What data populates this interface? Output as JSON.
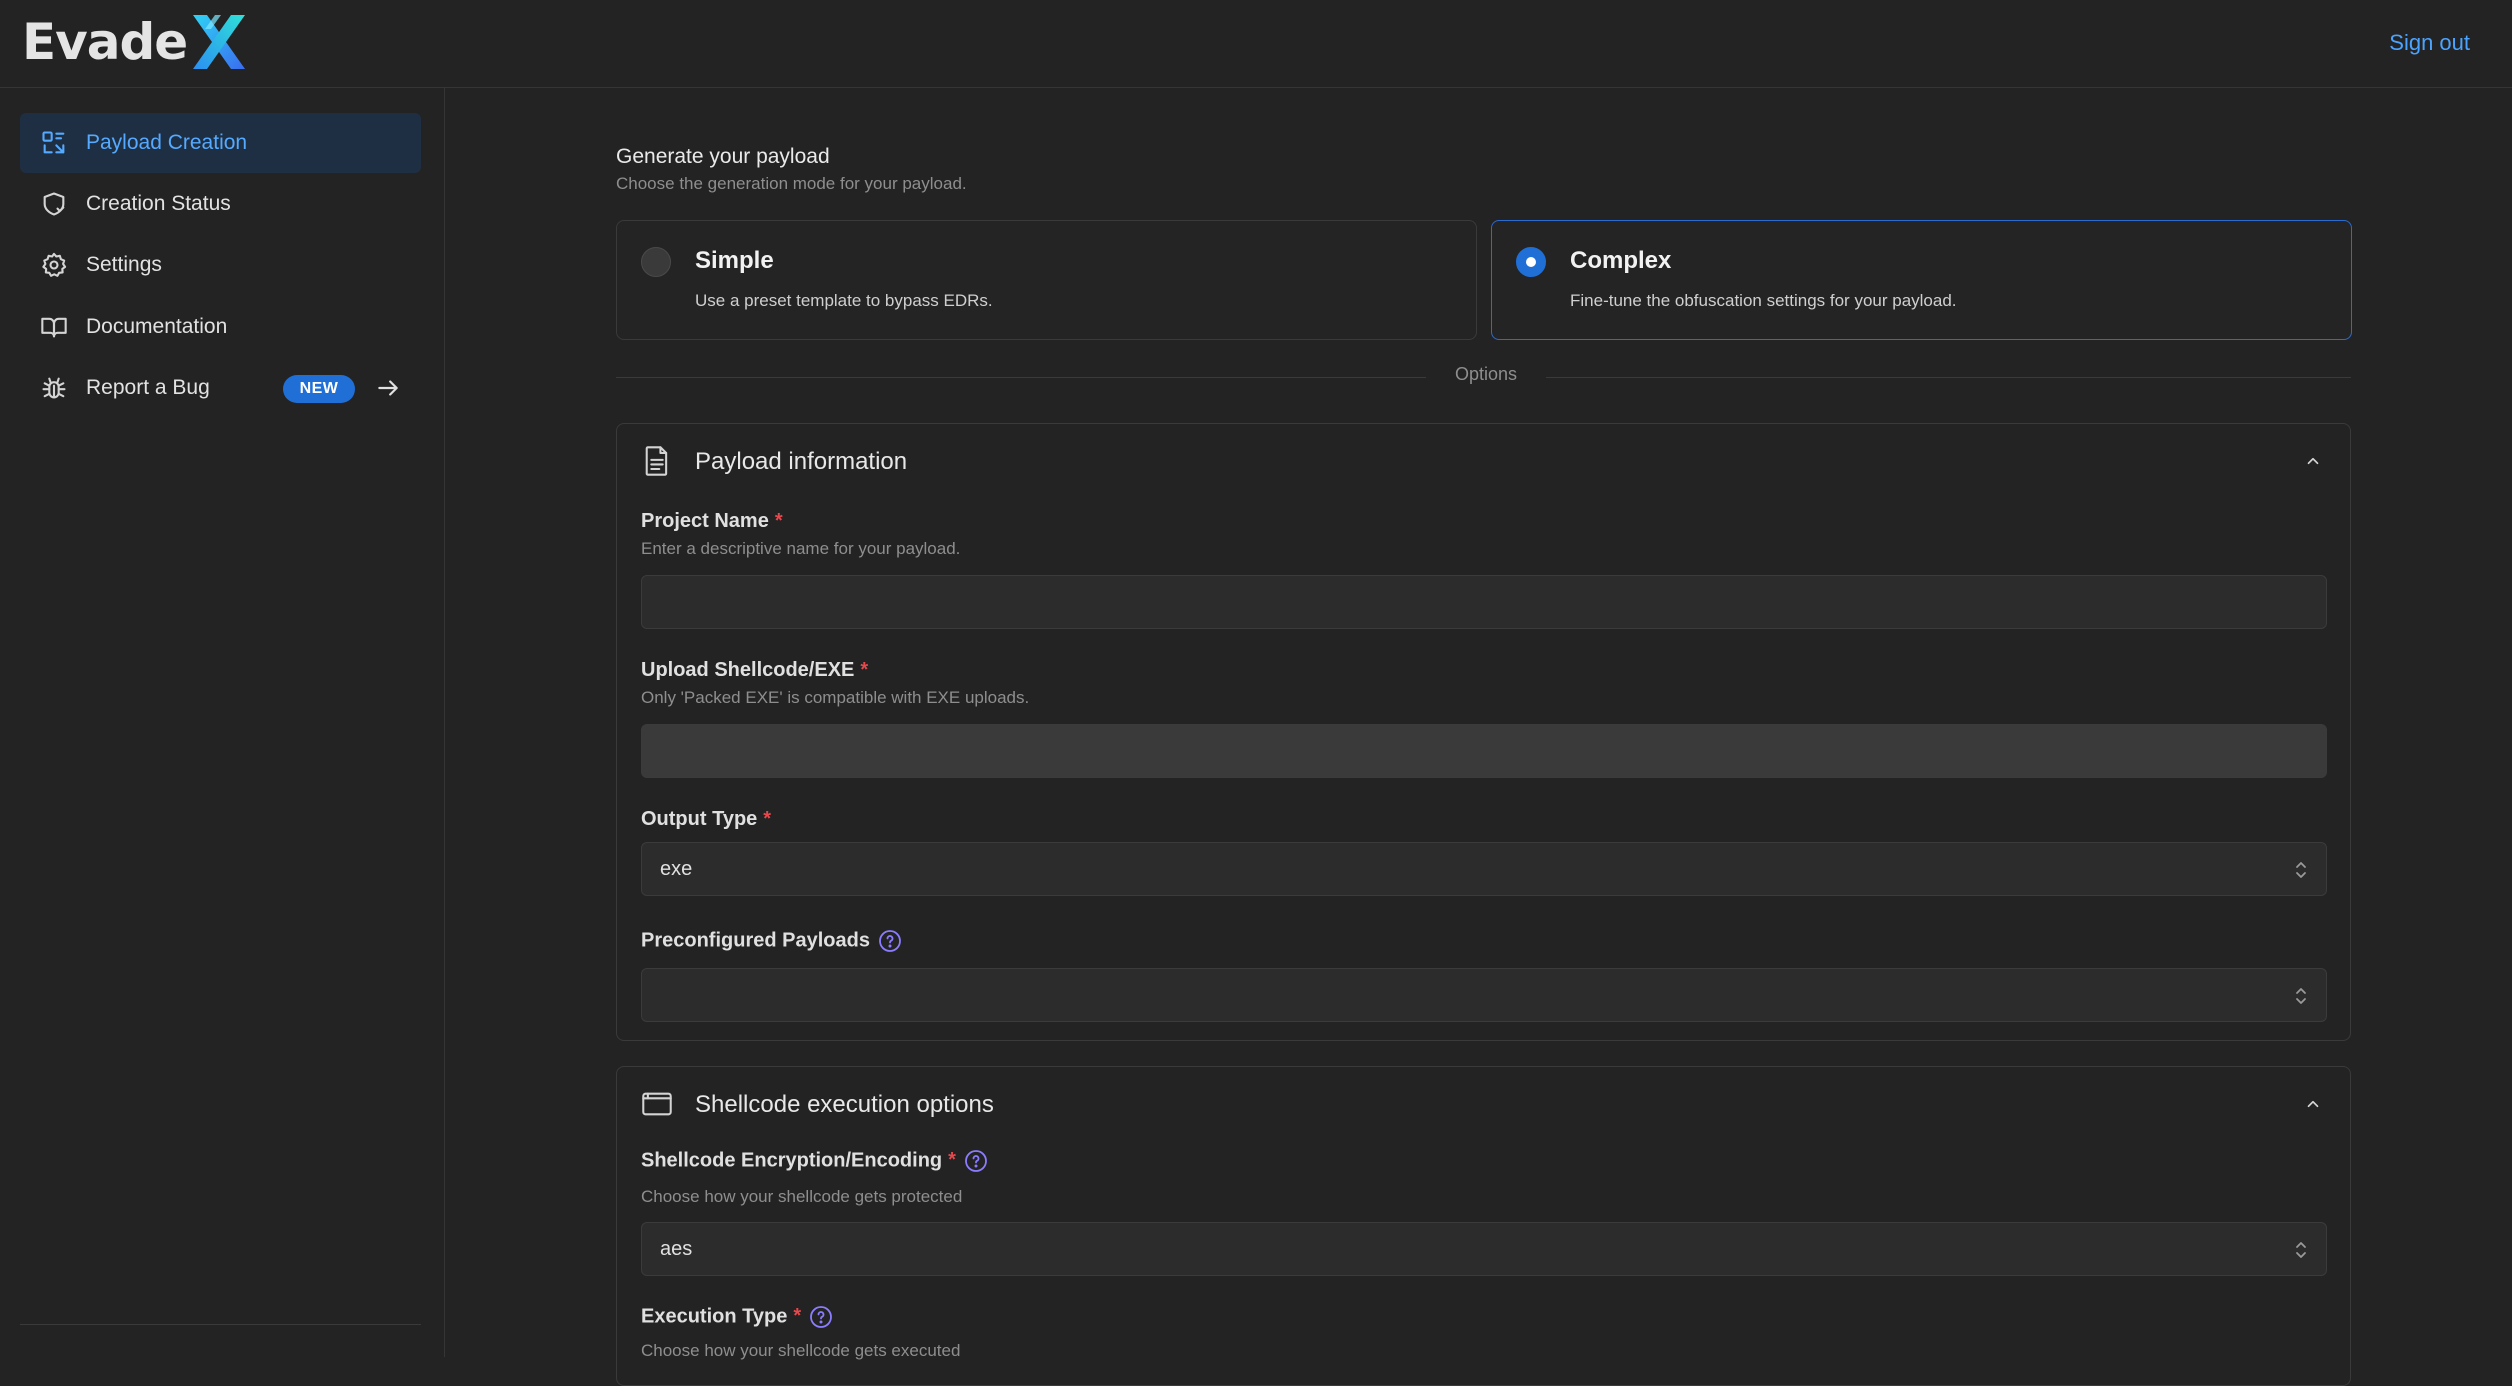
{
  "app": {
    "sign_out": "Sign out"
  },
  "sidebar": {
    "items": [
      {
        "label": "Payload Creation",
        "icon": "payload-creation-icon",
        "active": true
      },
      {
        "label": "Creation Status",
        "icon": "shield-check-icon"
      },
      {
        "label": "Settings",
        "icon": "gear-icon"
      },
      {
        "label": "Documentation",
        "icon": "book-icon"
      },
      {
        "label": "Report a Bug",
        "icon": "bug-icon",
        "badge": "NEW"
      }
    ]
  },
  "main": {
    "title": "Generate your payload",
    "subtitle": "Choose the generation mode for your payload.",
    "modes": [
      {
        "title": "Simple",
        "desc": "Use a preset template to bypass EDRs.",
        "selected": false
      },
      {
        "title": "Complex",
        "desc": "Fine-tune the obfuscation settings for your payload.",
        "selected": true
      }
    ],
    "options_label": "Options",
    "payload_info": {
      "title": "Payload information",
      "project_name": {
        "label": "Project Name",
        "hint": "Enter a descriptive name for your payload.",
        "value": ""
      },
      "upload": {
        "label": "Upload Shellcode/EXE",
        "hint": "Only 'Packed EXE' is compatible with EXE uploads."
      },
      "output_type": {
        "label": "Output Type",
        "value": "exe"
      },
      "preconfigured": {
        "label": "Preconfigured Payloads",
        "value": ""
      }
    },
    "shellcode": {
      "title": "Shellcode execution options",
      "encryption": {
        "label": "Shellcode Encryption/Encoding",
        "hint": "Choose how your shellcode gets protected",
        "value": "aes"
      },
      "execution": {
        "label": "Execution Type",
        "hint": "Choose how your shellcode gets executed"
      }
    }
  },
  "colors": {
    "accent": "#1f6fd6",
    "link": "#4aa3ff",
    "required": "#e5484d",
    "background": "#232323"
  }
}
